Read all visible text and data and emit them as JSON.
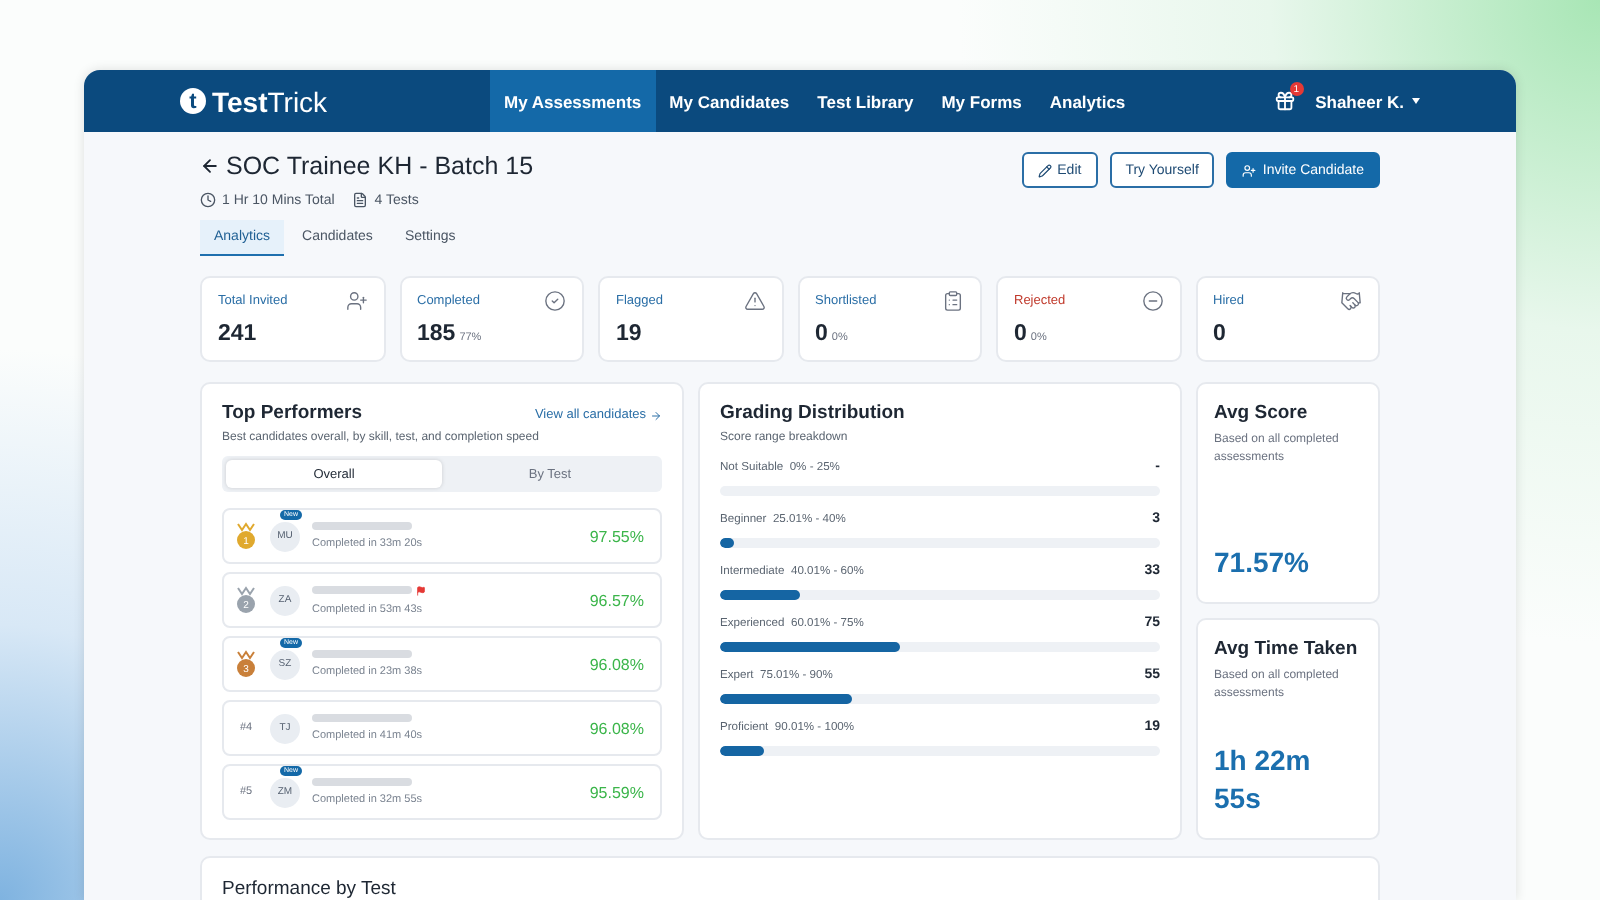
{
  "header": {
    "logo_letter": "t",
    "logo_text_bold": "Test",
    "logo_text": "Trick",
    "nav": [
      {
        "label": "My Assessments",
        "selected": true
      },
      {
        "label": "My Candidates",
        "selected": false
      },
      {
        "label": "Test Library",
        "selected": false
      },
      {
        "label": "My Forms",
        "selected": false
      },
      {
        "label": "Analytics",
        "selected": false
      }
    ],
    "notification_count": "1",
    "user": "Shaheer K."
  },
  "assessment": {
    "title": "SOC Trainee KH - Batch 15",
    "duration": "1 Hr 10 Mins Total",
    "tests": "4 Tests",
    "actions": [
      {
        "label": "Edit",
        "kind": "edit"
      },
      {
        "label": "Try Yourself",
        "kind": "plain"
      },
      {
        "label": "Invite Candidate",
        "kind": "primary"
      }
    ],
    "tabs": [
      {
        "label": "Analytics",
        "selected": true
      },
      {
        "label": "Candidates",
        "selected": false
      },
      {
        "label": "Settings",
        "selected": false
      }
    ]
  },
  "stats": [
    {
      "label": "Total Invited",
      "value": "241",
      "kind": "invited",
      "color": "#2a6ea6"
    },
    {
      "label": "Completed",
      "value": "185",
      "percent": "77%",
      "kind": "completed",
      "color": "#2a6ea6"
    },
    {
      "label": "Flagged",
      "value": "19",
      "kind": "flagged",
      "color": "#2a6ea6"
    },
    {
      "label": "Shortlisted",
      "value": "0",
      "percent": "0%",
      "kind": "shortlisted",
      "color": "#2a6ea6"
    },
    {
      "label": "Rejected",
      "value": "0",
      "percent": "0%",
      "kind": "rejected",
      "color": "#c0392b"
    },
    {
      "label": "Hired",
      "value": "0",
      "kind": "hired",
      "color": "#2a6ea6"
    }
  ],
  "top_performers": {
    "title": "Top Performers",
    "link": "View all candidates",
    "subtitle": "Best candidates overall, by skill, test, and completion speed",
    "segments": [
      {
        "label": "Overall",
        "selected": true
      },
      {
        "label": "By Test",
        "selected": false
      }
    ],
    "rows": [
      {
        "kind": "gold",
        "rank": "1",
        "initials": "MU",
        "new": true,
        "flagged": false,
        "badge": "New",
        "time": "Completed in 33m 20s",
        "score": "97.55%"
      },
      {
        "kind": "silver",
        "rank": "2",
        "initials": "ZA",
        "new": false,
        "flagged": true,
        "time": "Completed in 53m 43s",
        "score": "96.57%"
      },
      {
        "kind": "bronze",
        "rank": "3",
        "initials": "SZ",
        "new": true,
        "flagged": false,
        "badge": "New",
        "time": "Completed in 23m 38s",
        "score": "96.08%"
      },
      {
        "kind": "number",
        "rank": "#4",
        "initials": "TJ",
        "new": false,
        "flagged": false,
        "time": "Completed in 41m 40s",
        "score": "96.08%"
      },
      {
        "kind": "number",
        "rank": "#5",
        "initials": "ZM",
        "new": true,
        "flagged": false,
        "badge": "New",
        "time": "Completed in 32m 55s",
        "score": "95.59%"
      }
    ]
  },
  "grading": {
    "title": "Grading Distribution",
    "subtitle": "Score range breakdown",
    "bands": [
      {
        "name": "Not Suitable",
        "range": "0% - 25%",
        "count": "-",
        "level": 0
      },
      {
        "name": "Beginner",
        "range": "25.01% - 40%",
        "count": "3",
        "level": 0.03
      },
      {
        "name": "Intermediate",
        "range": "40.01% - 60%",
        "count": "33",
        "level": 0.18
      },
      {
        "name": "Experienced",
        "range": "60.01% - 75%",
        "count": "75",
        "level": 0.41
      },
      {
        "name": "Expert",
        "range": "75.01% - 90%",
        "count": "55",
        "level": 0.3
      },
      {
        "name": "Proficient",
        "range": "90.01% - 100%",
        "count": "19",
        "level": 0.1
      }
    ]
  },
  "summary": [
    {
      "title": "Avg Score",
      "note": "Based on all completed assessments",
      "value": "71.57%"
    },
    {
      "title": "Avg Time Taken",
      "note": "Based on all completed assessments",
      "value": "1h 22m 55s"
    }
  ],
  "performance_by_test": {
    "title": "Performance by Test"
  }
}
